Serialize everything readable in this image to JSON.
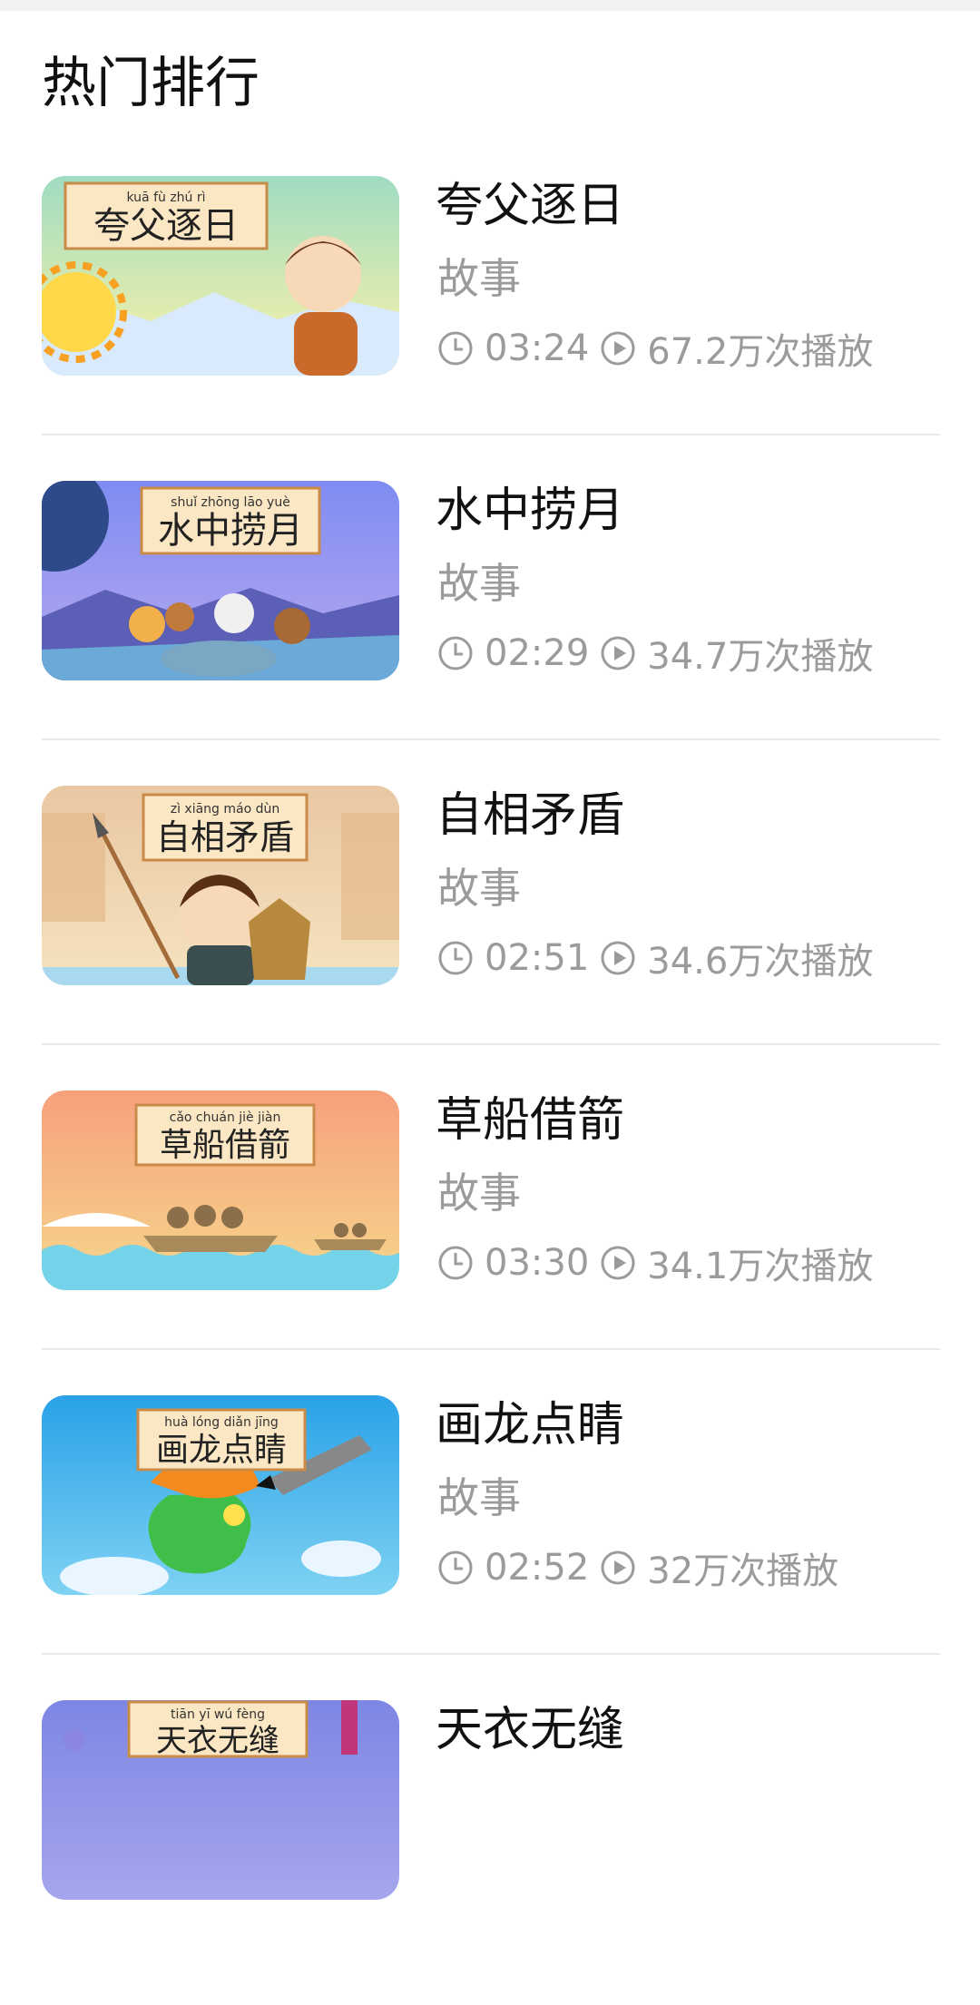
{
  "section": {
    "title": "热门排行"
  },
  "items": [
    {
      "title": "夸父逐日",
      "category": "故事",
      "duration": "03:24",
      "plays": "67.2万次播放",
      "thumb": {
        "pinyin": "kuā fù zhú rì",
        "chars": "夸父逐日",
        "bg_top": "#9fdcc2",
        "bg_bottom": "#fff3a6",
        "ground": "#d9eafc",
        "icon": "sun-boy-icon"
      }
    },
    {
      "title": "水中捞月",
      "category": "故事",
      "duration": "02:29",
      "plays": "34.7万次播放",
      "thumb": {
        "pinyin": "shuǐ zhōng lāo yuè",
        "chars": "水中捞月",
        "bg_top": "#7f8cf2",
        "bg_bottom": "#b7a9ef",
        "ground": "#6aa9d8",
        "icon": "monkeys-well-icon"
      }
    },
    {
      "title": "自相矛盾",
      "category": "故事",
      "duration": "02:51",
      "plays": "34.6万次播放",
      "thumb": {
        "pinyin": "zì xiāng máo dùn",
        "chars": "自相矛盾",
        "bg_top": "#e9c7a3",
        "bg_bottom": "#f6e3bf",
        "ground": "#a8d9ee",
        "icon": "spear-shield-icon"
      }
    },
    {
      "title": "草船借箭",
      "category": "故事",
      "duration": "03:30",
      "plays": "34.1万次播放",
      "thumb": {
        "pinyin": "cǎo chuán jiè jiàn",
        "chars": "草船借箭",
        "bg_top": "#f7a07c",
        "bg_bottom": "#f6d78c",
        "ground": "#74d3e8",
        "icon": "boats-icon"
      }
    },
    {
      "title": "画龙点睛",
      "category": "故事",
      "duration": "02:52",
      "plays": "32万次播放",
      "thumb": {
        "pinyin": "huà lóng diǎn jīng",
        "chars": "画龙点睛",
        "bg_top": "#2aa2e8",
        "bg_bottom": "#7fd2f3",
        "ground": "#e9f6ff",
        "icon": "dragon-icon"
      }
    },
    {
      "title": "天衣无缝",
      "category": "",
      "duration": "",
      "plays": "",
      "thumb": {
        "pinyin": "tiān yī wú fèng",
        "chars": "天衣无缝",
        "bg_top": "#7d86e3",
        "bg_bottom": "#a6a6ee",
        "ground": "#8a86e0",
        "icon": "celestial-icon"
      }
    }
  ],
  "icons": {
    "clock": "clock-icon",
    "play": "play-circle-icon"
  }
}
